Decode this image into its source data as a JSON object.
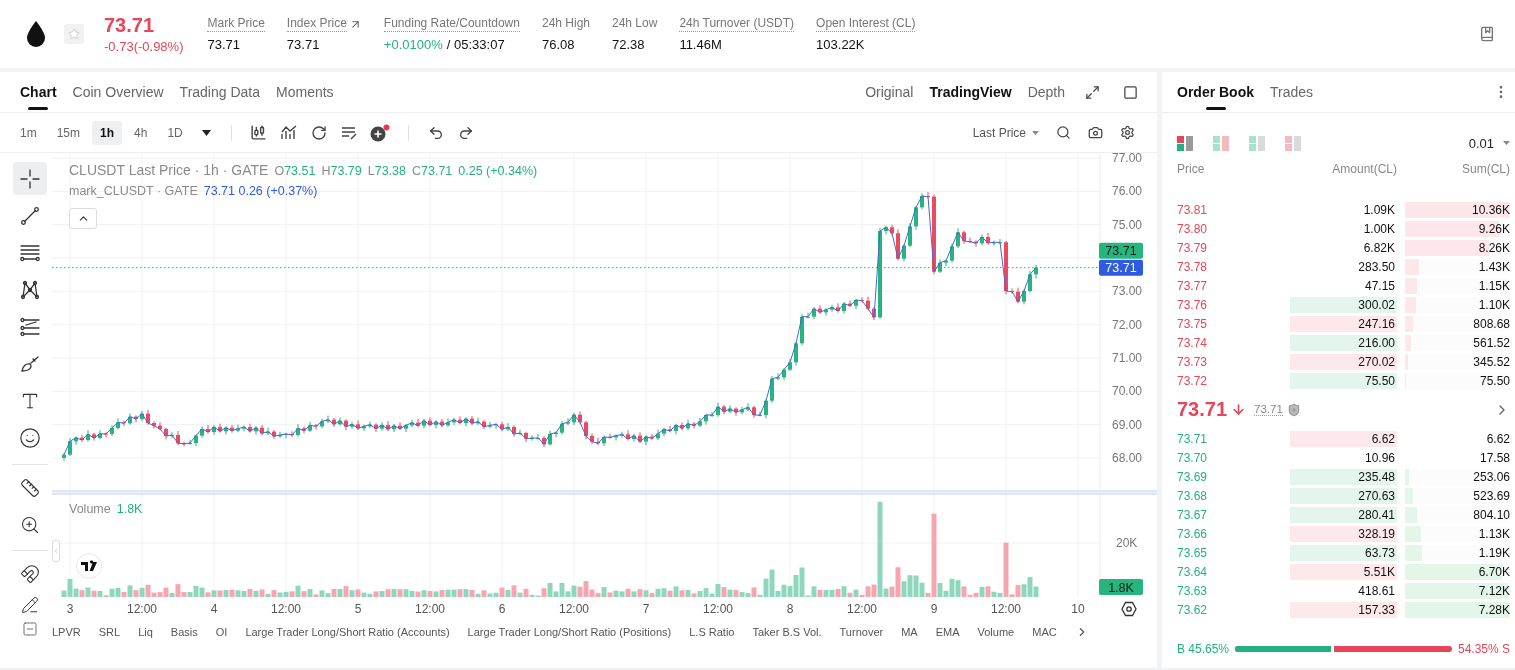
{
  "header": {
    "price": "73.71",
    "change": "-0.73(-0.98%)",
    "favorite": false,
    "stats": [
      {
        "kind": "value",
        "label": "Mark Price",
        "value": "73.71",
        "has_tooltip": true,
        "link": false
      },
      {
        "kind": "value",
        "label": "Index Price",
        "value": "73.71",
        "has_tooltip": true,
        "link": true
      },
      {
        "kind": "funding",
        "label": "Funding Rate/Countdown",
        "rate": "+0.0100%",
        "countdown": "/ 05:33:07",
        "has_tooltip": true,
        "link": false
      },
      {
        "kind": "value",
        "label": "24h High",
        "value": "76.08",
        "has_tooltip": false,
        "link": false
      },
      {
        "kind": "value",
        "label": "24h Low",
        "value": "72.38",
        "has_tooltip": false,
        "link": false
      },
      {
        "kind": "value",
        "label": "24h Turnover (USDT)",
        "value": "11.46M",
        "has_tooltip": true,
        "link": false
      },
      {
        "kind": "value",
        "label": "Open Interest (CL)",
        "value": "103.22K",
        "has_tooltip": true,
        "link": false
      }
    ]
  },
  "chart": {
    "tabs": [
      {
        "label": "Chart",
        "selected": true
      },
      {
        "label": "Coin Overview",
        "selected": false
      },
      {
        "label": "Trading Data",
        "selected": false
      },
      {
        "label": "Moments",
        "selected": false
      }
    ],
    "views": [
      {
        "label": "Original",
        "selected": false
      },
      {
        "label": "TradingView",
        "selected": true
      },
      {
        "label": "Depth",
        "selected": false
      }
    ],
    "intervals": [
      {
        "label": "1m",
        "selected": false
      },
      {
        "label": "15m",
        "selected": false
      },
      {
        "label": "1h",
        "selected": true
      },
      {
        "label": "4h",
        "selected": false
      },
      {
        "label": "1D",
        "selected": false
      }
    ],
    "indicator_badge": true,
    "price_source": "Last Price",
    "drawing_tool_groups": [
      [
        {
          "kind": "crosshair",
          "selected": true
        },
        {
          "kind": "trend-line",
          "selected": false
        },
        {
          "kind": "parallel-lines",
          "selected": false
        },
        {
          "kind": "pattern",
          "selected": false
        },
        {
          "kind": "fib-levels",
          "selected": false
        },
        {
          "kind": "brush",
          "selected": false
        },
        {
          "kind": "text",
          "selected": false
        },
        {
          "kind": "emoji",
          "selected": false
        }
      ],
      [
        {
          "kind": "ruler",
          "selected": false
        },
        {
          "kind": "zoom",
          "selected": false
        }
      ],
      [
        {
          "kind": "magnet",
          "selected": false
        },
        {
          "kind": "lock-drawing",
          "selected": false
        }
      ]
    ],
    "legend": {
      "title": "CLUSDT Last Price · 1h · GATE",
      "ohlc": [
        {
          "key": "O",
          "value": "73.51"
        },
        {
          "key": "H",
          "value": "73.79"
        },
        {
          "key": "L",
          "value": "73.38"
        },
        {
          "key": "C",
          "value": "73.71"
        }
      ],
      "change": "0.25 (+0.34%)",
      "mark_value": "73.71 0.26 (+0.37%)"
    },
    "chart_data": {
      "type": "candlestick",
      "grid": true,
      "ylim": [
        63.83,
        77.15
      ],
      "yticks": [
        {
          "value": 77,
          "label": "77.00"
        },
        {
          "value": 76,
          "label": "76.00"
        },
        {
          "value": 75,
          "label": "75.00"
        },
        {
          "value": 73,
          "label": "73.00"
        },
        {
          "value": 72,
          "label": "72.00"
        },
        {
          "value": 71,
          "label": "71.00"
        },
        {
          "value": 70,
          "label": "70.00"
        },
        {
          "value": 69,
          "label": "69.00"
        },
        {
          "value": 68,
          "label": "68.00"
        }
      ],
      "categories": [
        null,
        null,
        null,
        null,
        null,
        null,
        null,
        null,
        null,
        null,
        null,
        null,
        null,
        null,
        null,
        null,
        null,
        null,
        null,
        null,
        null,
        null,
        null,
        null,
        null,
        null,
        null,
        null,
        null,
        null,
        null,
        null,
        null,
        null,
        null,
        null,
        null,
        null,
        null,
        null,
        null,
        null,
        null,
        null,
        null,
        null,
        null,
        null,
        null,
        null,
        null,
        null,
        null,
        null,
        null,
        null,
        null,
        null,
        null,
        null,
        null,
        null,
        null,
        null,
        null,
        null,
        null,
        null,
        null,
        null,
        null,
        null,
        null,
        null,
        null,
        null,
        null,
        null,
        null,
        null,
        null,
        null,
        null,
        null,
        null,
        null,
        null,
        null,
        null,
        null,
        null,
        null,
        null,
        null,
        null,
        null,
        null,
        null,
        null,
        null,
        null,
        null,
        null,
        null,
        null,
        null,
        null,
        null,
        null,
        null,
        null,
        null,
        null,
        null,
        null,
        null,
        null,
        null,
        null,
        null,
        null,
        null,
        null,
        null,
        null,
        null,
        null,
        null,
        null,
        null,
        null,
        null,
        null,
        null,
        null,
        null,
        null,
        null,
        null,
        null,
        null,
        null,
        null,
        null,
        null,
        null,
        null,
        null,
        null,
        null,
        null,
        null,
        null,
        null,
        null,
        null,
        null,
        null,
        null,
        null,
        null,
        null,
        null
      ],
      "ohlc": [
        [
          68.0,
          68.15,
          67.92,
          68.1
        ],
        [
          68.1,
          68.6,
          68.06,
          68.5
        ],
        [
          68.5,
          68.65,
          68.4,
          68.61
        ],
        [
          68.61,
          68.69,
          68.48,
          68.54
        ],
        [
          68.54,
          68.83,
          68.49,
          68.71
        ],
        [
          68.71,
          68.76,
          68.52,
          68.6
        ],
        [
          68.6,
          68.83,
          68.56,
          68.73
        ],
        [
          68.73,
          68.77,
          68.62,
          68.72
        ],
        [
          68.72,
          68.98,
          68.66,
          68.9
        ],
        [
          68.9,
          69.19,
          68.85,
          69.07
        ],
        [
          69.07,
          69.12,
          68.96,
          69.04
        ],
        [
          69.04,
          69.34,
          69.0,
          69.24
        ],
        [
          69.24,
          69.28,
          69.07,
          69.17
        ],
        [
          69.17,
          69.41,
          69.11,
          69.33
        ],
        [
          69.33,
          69.45,
          69.0,
          69.05
        ],
        [
          69.05,
          69.1,
          68.89,
          68.97
        ],
        [
          68.97,
          69.07,
          68.83,
          68.87
        ],
        [
          68.87,
          68.91,
          68.56,
          68.66
        ],
        [
          68.66,
          68.77,
          68.6,
          68.69
        ],
        [
          68.69,
          68.81,
          68.39,
          68.44
        ],
        [
          68.44,
          68.49,
          68.35,
          68.43
        ],
        [
          68.43,
          68.55,
          68.39,
          68.45
        ],
        [
          68.45,
          68.71,
          68.35,
          68.67
        ],
        [
          68.67,
          68.95,
          68.61,
          68.87
        ],
        [
          68.87,
          68.99,
          68.73,
          68.78
        ],
        [
          68.78,
          68.98,
          68.7,
          68.93
        ],
        [
          68.93,
          69.03,
          68.76,
          68.8
        ],
        [
          68.8,
          68.95,
          68.7,
          68.91
        ],
        [
          68.91,
          68.99,
          68.76,
          68.82
        ],
        [
          68.82,
          69.0,
          68.77,
          68.88
        ],
        [
          68.88,
          68.98,
          68.8,
          68.93
        ],
        [
          68.93,
          69.03,
          68.76,
          68.8
        ],
        [
          68.8,
          68.95,
          68.7,
          68.91
        ],
        [
          68.91,
          68.99,
          68.68,
          68.74
        ],
        [
          68.74,
          68.91,
          68.69,
          68.79
        ],
        [
          68.79,
          68.84,
          68.57,
          68.65
        ],
        [
          68.65,
          68.79,
          68.61,
          68.69
        ],
        [
          68.69,
          68.76,
          68.59,
          68.72
        ],
        [
          68.72,
          68.8,
          68.63,
          68.69
        ],
        [
          68.69,
          69.01,
          68.64,
          68.89
        ],
        [
          68.89,
          68.94,
          68.74,
          68.82
        ],
        [
          68.82,
          69.08,
          68.78,
          68.98
        ],
        [
          68.98,
          69.02,
          68.85,
          68.95
        ],
        [
          68.95,
          69.18,
          68.89,
          69.1
        ],
        [
          69.1,
          69.27,
          69.05,
          69.15
        ],
        [
          69.15,
          69.2,
          68.93,
          69.01
        ],
        [
          69.01,
          69.22,
          68.97,
          69.12
        ],
        [
          69.12,
          69.16,
          68.84,
          68.94
        ],
        [
          68.94,
          69.09,
          68.88,
          69.01
        ],
        [
          69.01,
          69.13,
          68.84,
          68.89
        ],
        [
          68.89,
          69.0,
          68.81,
          68.95
        ],
        [
          68.95,
          69.1,
          68.91,
          69.0
        ],
        [
          69.0,
          69.04,
          68.78,
          68.88
        ],
        [
          68.88,
          69.07,
          68.82,
          68.99
        ],
        [
          68.99,
          69.11,
          68.81,
          68.86
        ],
        [
          68.86,
          69.02,
          68.78,
          68.97
        ],
        [
          68.97,
          69.07,
          68.84,
          68.88
        ],
        [
          68.88,
          69.02,
          68.78,
          68.98
        ],
        [
          68.98,
          69.14,
          68.92,
          69.06
        ],
        [
          69.06,
          69.18,
          68.92,
          68.97
        ],
        [
          68.97,
          69.17,
          68.89,
          69.12
        ],
        [
          69.12,
          69.22,
          68.95,
          68.99
        ],
        [
          68.99,
          69.13,
          68.89,
          69.09
        ],
        [
          69.09,
          69.17,
          68.92,
          68.98
        ],
        [
          68.98,
          69.19,
          68.93,
          69.07
        ],
        [
          69.07,
          69.2,
          68.99,
          69.15
        ],
        [
          69.15,
          69.25,
          69.01,
          69.05
        ],
        [
          69.05,
          69.22,
          68.95,
          69.18
        ],
        [
          69.18,
          69.26,
          68.98,
          69.04
        ],
        [
          69.04,
          69.21,
          68.99,
          69.09
        ],
        [
          69.09,
          69.14,
          68.86,
          68.94
        ],
        [
          68.94,
          69.08,
          68.9,
          68.98
        ],
        [
          68.98,
          69.05,
          68.88,
          69.01
        ],
        [
          69.01,
          69.09,
          68.8,
          68.86
        ],
        [
          68.86,
          69.05,
          68.81,
          68.93
        ],
        [
          68.93,
          68.98,
          68.64,
          68.72
        ],
        [
          68.72,
          68.85,
          68.68,
          68.75
        ],
        [
          68.75,
          68.79,
          68.48,
          68.58
        ],
        [
          68.58,
          68.68,
          68.52,
          68.6
        ],
        [
          68.6,
          68.72,
          68.55,
          68.6
        ],
        [
          68.6,
          68.65,
          68.33,
          68.41
        ],
        [
          68.41,
          68.82,
          68.37,
          68.72
        ],
        [
          68.72,
          68.8,
          68.62,
          68.76
        ],
        [
          68.76,
          69.11,
          68.7,
          69.03
        ],
        [
          69.03,
          69.19,
          68.98,
          69.07
        ],
        [
          69.07,
          69.35,
          68.99,
          69.3
        ],
        [
          69.3,
          69.4,
          69.03,
          69.07
        ],
        [
          69.07,
          69.11,
          68.56,
          68.66
        ],
        [
          68.66,
          68.74,
          68.43,
          68.49
        ],
        [
          68.49,
          68.61,
          68.39,
          68.44
        ],
        [
          68.44,
          68.68,
          68.36,
          68.63
        ],
        [
          68.63,
          68.73,
          68.58,
          68.62
        ],
        [
          68.62,
          68.71,
          68.52,
          68.67
        ],
        [
          68.67,
          68.79,
          68.61,
          68.71
        ],
        [
          68.71,
          68.83,
          68.52,
          68.57
        ],
        [
          68.57,
          68.72,
          68.49,
          68.67
        ],
        [
          68.67,
          68.77,
          68.45,
          68.49
        ],
        [
          68.49,
          68.68,
          68.39,
          68.64
        ],
        [
          68.64,
          68.72,
          68.53,
          68.59
        ],
        [
          68.59,
          68.85,
          68.54,
          68.73
        ],
        [
          68.73,
          68.91,
          68.65,
          68.86
        ],
        [
          68.86,
          68.96,
          68.77,
          68.81
        ],
        [
          68.81,
          69.03,
          68.71,
          68.99
        ],
        [
          68.99,
          69.07,
          68.83,
          68.89
        ],
        [
          68.89,
          69.15,
          68.84,
          69.03
        ],
        [
          69.03,
          69.08,
          68.89,
          68.97
        ],
        [
          68.97,
          69.2,
          68.93,
          69.1
        ],
        [
          69.1,
          69.33,
          69.0,
          69.29
        ],
        [
          69.29,
          69.37,
          69.23,
          69.29
        ],
        [
          69.29,
          69.66,
          69.24,
          69.54
        ],
        [
          69.54,
          69.59,
          69.31,
          69.39
        ],
        [
          69.39,
          69.58,
          69.35,
          69.48
        ],
        [
          69.48,
          69.52,
          69.27,
          69.37
        ],
        [
          69.37,
          69.53,
          69.31,
          69.45
        ],
        [
          69.45,
          69.64,
          69.4,
          69.52
        ],
        [
          69.52,
          69.57,
          69.21,
          69.29
        ],
        [
          69.29,
          69.39,
          69.25,
          69.29
        ],
        [
          69.29,
          69.76,
          69.19,
          69.72
        ],
        [
          69.72,
          70.46,
          69.66,
          70.38
        ],
        [
          70.38,
          70.54,
          70.33,
          70.42
        ],
        [
          70.42,
          70.7,
          70.34,
          70.65
        ],
        [
          70.65,
          70.97,
          70.61,
          70.87
        ],
        [
          70.87,
          71.48,
          70.77,
          71.44
        ],
        [
          71.44,
          72.32,
          71.38,
          72.24
        ],
        [
          72.24,
          72.36,
          72.19,
          72.24
        ],
        [
          72.24,
          72.53,
          72.16,
          72.48
        ],
        [
          72.48,
          72.58,
          72.33,
          72.37
        ],
        [
          72.37,
          72.49,
          72.27,
          72.45
        ],
        [
          72.45,
          72.6,
          72.39,
          72.52
        ],
        [
          72.52,
          72.64,
          72.36,
          72.41
        ],
        [
          72.41,
          72.68,
          72.33,
          72.63
        ],
        [
          72.63,
          72.73,
          72.53,
          72.57
        ],
        [
          72.57,
          72.78,
          72.47,
          72.74
        ],
        [
          72.74,
          72.82,
          72.66,
          72.72
        ],
        [
          72.72,
          72.84,
          72.43,
          72.48
        ],
        [
          72.48,
          72.53,
          72.14,
          72.22
        ],
        [
          72.22,
          74.91,
          72.18,
          74.81
        ],
        [
          74.81,
          74.96,
          74.71,
          74.92
        ],
        [
          74.92,
          75.0,
          74.68,
          74.74
        ],
        [
          74.74,
          74.86,
          73.93,
          73.98
        ],
        [
          73.98,
          74.42,
          73.9,
          74.37
        ],
        [
          74.37,
          75.05,
          74.33,
          74.95
        ],
        [
          74.95,
          75.56,
          74.85,
          75.52
        ],
        [
          75.52,
          75.94,
          75.46,
          75.86
        ],
        [
          75.86,
          75.98,
          75.79,
          75.84
        ],
        [
          75.84,
          75.89,
          73.51,
          73.59
        ],
        [
          73.59,
          73.96,
          73.55,
          73.86
        ],
        [
          73.86,
          73.96,
          73.76,
          73.92
        ],
        [
          73.92,
          74.43,
          73.86,
          74.35
        ],
        [
          74.35,
          74.89,
          74.3,
          74.77
        ],
        [
          74.77,
          74.82,
          74.43,
          74.51
        ],
        [
          74.51,
          74.61,
          74.45,
          74.49
        ],
        [
          74.49,
          74.53,
          74.34,
          74.44
        ],
        [
          74.44,
          74.71,
          74.38,
          74.63
        ],
        [
          74.63,
          74.75,
          74.4,
          74.45
        ],
        [
          74.45,
          74.52,
          74.37,
          74.47
        ],
        [
          74.47,
          74.57,
          74.43,
          74.47
        ],
        [
          74.47,
          74.51,
          72.91,
          73.01
        ],
        [
          73.01,
          73.09,
          72.93,
          72.99
        ],
        [
          72.99,
          73.11,
          72.64,
          72.69
        ],
        [
          72.69,
          73.06,
          72.61,
          73.01
        ],
        [
          73.01,
          73.61,
          72.97,
          73.51
        ],
        [
          73.51,
          73.79,
          73.38,
          73.71
        ]
      ],
      "series": [
        {
          "name": "mark_CLUSDT · GATE",
          "type": "line",
          "color": "#4a66d8",
          "values": [
            68.1,
            68.5,
            68.61,
            68.54,
            68.71,
            68.6,
            68.73,
            68.72,
            68.9,
            69.07,
            69.04,
            69.24,
            69.17,
            69.33,
            69.05,
            68.97,
            68.87,
            68.66,
            68.69,
            68.44,
            68.43,
            68.45,
            68.67,
            68.87,
            68.78,
            68.93,
            68.8,
            68.91,
            68.82,
            68.88,
            68.93,
            68.8,
            68.91,
            68.74,
            68.79,
            68.65,
            68.69,
            68.72,
            68.69,
            68.89,
            68.82,
            68.98,
            68.95,
            69.1,
            69.15,
            69.01,
            69.12,
            68.94,
            69.01,
            68.89,
            68.95,
            69.0,
            68.88,
            68.99,
            68.86,
            68.97,
            68.88,
            68.98,
            69.06,
            68.97,
            69.12,
            68.99,
            69.09,
            68.98,
            69.07,
            69.15,
            69.05,
            69.18,
            69.04,
            69.09,
            68.94,
            68.98,
            69.01,
            68.86,
            68.93,
            68.72,
            68.75,
            68.58,
            68.6,
            68.6,
            68.41,
            68.72,
            68.76,
            69.03,
            69.07,
            69.3,
            69.07,
            68.66,
            68.49,
            68.44,
            68.63,
            68.62,
            68.67,
            68.71,
            68.57,
            68.67,
            68.49,
            68.64,
            68.59,
            68.73,
            68.86,
            68.81,
            68.99,
            68.89,
            69.03,
            68.97,
            69.1,
            69.29,
            69.29,
            69.54,
            69.39,
            69.48,
            69.37,
            69.45,
            69.52,
            69.29,
            69.29,
            69.72,
            70.38,
            70.42,
            70.65,
            70.87,
            71.44,
            72.24,
            72.24,
            72.48,
            72.37,
            72.45,
            72.52,
            72.41,
            72.63,
            72.57,
            72.74,
            72.72,
            72.48,
            72.22,
            74.81,
            74.92,
            74.74,
            73.98,
            74.37,
            74.95,
            75.52,
            75.86,
            75.84,
            73.59,
            73.86,
            73.92,
            74.35,
            74.77,
            74.51,
            74.49,
            74.44,
            74.63,
            74.45,
            74.47,
            74.47,
            73.01,
            72.99,
            72.69,
            73.01,
            73.51,
            73.71
          ]
        }
      ],
      "ref_lines": [
        {
          "axis": "y",
          "value": 73.71,
          "color": "#26b47f"
        }
      ]
    },
    "price_tags": [
      {
        "kind": "last",
        "label": "73.71"
      },
      {
        "kind": "mark",
        "label": "73.71"
      }
    ],
    "volume": {
      "title": "Volume",
      "value": "1.8K",
      "axis": [
        "20K"
      ],
      "tag": "1.8K"
    },
    "time_axis": [
      "3",
      "12:00",
      "4",
      "12:00",
      "5",
      "12:00",
      "6",
      "12:00",
      "7",
      "12:00",
      "8",
      "12:00",
      "9",
      "12:00",
      "10"
    ],
    "indicators": [
      "LPVR",
      "SRL",
      "Liq",
      "Basis",
      "OI",
      "Large Trader Long/Short Ratio (Accounts)",
      "Large Trader Long/Short Ratio (Positions)",
      "L.S Ratio",
      "Taker B.S Vol.",
      "Turnover",
      "MA",
      "EMA",
      "Volume",
      "MAC"
    ]
  },
  "order_book": {
    "tabs": [
      {
        "label": "Order Book",
        "selected": true
      },
      {
        "label": "Trades",
        "selected": false
      }
    ],
    "layouts": [
      {
        "kind": "both",
        "selected": true
      },
      {
        "kind": "split",
        "selected": false
      },
      {
        "kind": "bids",
        "selected": false
      },
      {
        "kind": "asks",
        "selected": false
      }
    ],
    "precision": "0.01",
    "columns": [
      "Price",
      "Amount(CL)",
      "Sum(CL)"
    ],
    "asks": [
      {
        "price": "73.81",
        "amount": "1.09K",
        "sum": "10.36K",
        "level": 1
      },
      {
        "price": "73.80",
        "amount": "1.00K",
        "sum": "9.26K",
        "level": 0.894
      },
      {
        "price": "73.79",
        "amount": "6.82K",
        "sum": "8.26K",
        "level": 0.797
      },
      {
        "price": "73.78",
        "amount": "283.50",
        "sum": "1.43K",
        "level": 0.138
      },
      {
        "price": "73.77",
        "amount": "47.15",
        "sum": "1.15K",
        "level": 0.111
      },
      {
        "price": "73.76",
        "amount": "300.02",
        "sum": "1.10K",
        "level": 0.106,
        "color": "#e3f5ec"
      },
      {
        "price": "73.75",
        "amount": "247.16",
        "sum": "808.68",
        "level": 0.078,
        "color": "#fde9ec"
      },
      {
        "price": "73.74",
        "amount": "216.00",
        "sum": "561.52",
        "level": 0.054,
        "color": "#e3f5ec"
      },
      {
        "price": "73.73",
        "amount": "270.02",
        "sum": "345.52",
        "level": 0.033,
        "color": "#fde9ec"
      },
      {
        "price": "73.72",
        "amount": "75.50",
        "sum": "75.50",
        "level": 0.007,
        "color": "#e3f5ec"
      }
    ],
    "mid": {
      "price": "73.71",
      "mark": "73.71"
    },
    "bids": [
      {
        "price": "73.71",
        "amount": "6.62",
        "sum": "6.62",
        "color": "#fde9ec"
      },
      {
        "price": "73.70",
        "amount": "10.96",
        "sum": "17.58"
      },
      {
        "price": "73.69",
        "amount": "235.48",
        "sum": "253.06",
        "level": 0.035,
        "color": "#e3f5ec"
      },
      {
        "price": "73.68",
        "amount": "270.63",
        "sum": "523.69",
        "level": 0.072,
        "color": "#e3f5ec"
      },
      {
        "price": "73.67",
        "amount": "280.41",
        "sum": "804.10",
        "level": 0.11,
        "color": "#e3f5ec"
      },
      {
        "price": "73.66",
        "amount": "328.19",
        "sum": "1.13K",
        "level": 0.155,
        "color": "#fde9ec"
      },
      {
        "price": "73.65",
        "amount": "63.73",
        "sum": "1.19K",
        "level": 0.163,
        "color": "#e3f5ec"
      },
      {
        "price": "73.64",
        "amount": "5.51K",
        "sum": "6.70K",
        "level": 0.92,
        "color": "#fde9ec"
      },
      {
        "price": "73.63",
        "amount": "418.61",
        "sum": "7.12K",
        "level": 0.978
      },
      {
        "price": "73.62",
        "amount": "157.33",
        "sum": "7.28K",
        "level": 1,
        "color": "#fde9ec"
      }
    ],
    "ratio": {
      "buy": "B 45.65%",
      "sell": "54.35% S",
      "level": 0.4565
    }
  }
}
